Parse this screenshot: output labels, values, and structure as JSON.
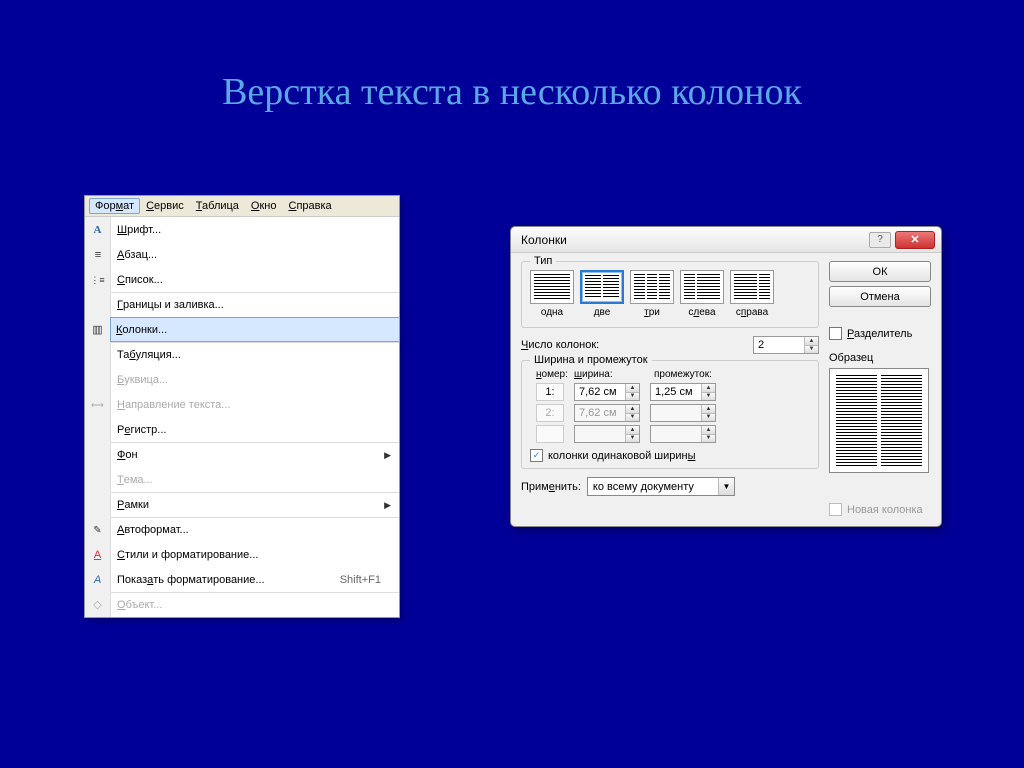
{
  "title": "Верстка текста в несколько колонок",
  "menubar": [
    {
      "label": "Формат",
      "mnemonic_index": 3
    },
    {
      "label": "Сервис",
      "mnemonic_index": 0
    },
    {
      "label": "Таблица",
      "mnemonic_index": 0
    },
    {
      "label": "Окно",
      "mnemonic_index": 0
    },
    {
      "label": "Справка",
      "mnemonic_index": 0
    }
  ],
  "menu_items": [
    {
      "id": "font",
      "label": "Шрифт...",
      "icon": "ic-font"
    },
    {
      "id": "paragraph",
      "label": "Абзац...",
      "icon": "ic-para"
    },
    {
      "id": "list",
      "label": "Список...",
      "icon": "ic-list"
    },
    {
      "id": "borders",
      "label": "Границы и заливка...",
      "sep": true
    },
    {
      "id": "columns",
      "label": "Колонки...",
      "icon": "ic-cols",
      "highlight": true
    },
    {
      "id": "tabs",
      "label": "Табуляция...",
      "sep": true
    },
    {
      "id": "dropcap",
      "label": "Буквица...",
      "disabled": true
    },
    {
      "id": "textdir",
      "label": "Направление текста...",
      "icon": "ic-dir",
      "disabled": true
    },
    {
      "id": "register",
      "label": "Регистр...",
      "sep": true
    },
    {
      "id": "background",
      "label": "Фон",
      "sep": true,
      "submenu": true
    },
    {
      "id": "theme",
      "label": "Тема...",
      "disabled": true
    },
    {
      "id": "frames",
      "label": "Рамки",
      "sep": true,
      "submenu": true
    },
    {
      "id": "autoformat",
      "label": "Автоформат...",
      "icon": "ic-autofmt",
      "sep": true
    },
    {
      "id": "styles",
      "label": "Стили и форматирование...",
      "icon": "ic-styles"
    },
    {
      "id": "revealfmt",
      "label": "Показать форматирование...",
      "icon": "ic-showfmt",
      "shortcut": "Shift+F1"
    },
    {
      "id": "object",
      "label": "Объект...",
      "icon": "ic-obj",
      "sep": true,
      "disabled": true
    }
  ],
  "dialog": {
    "title": "Колонки",
    "ok": "ОК",
    "cancel": "Отмена",
    "type_group": "Тип",
    "types": [
      "одна",
      "две",
      "три",
      "слева",
      "справа"
    ],
    "selected_type_index": 1,
    "count_label": "Число колонок:",
    "count_value": "2",
    "separator_label": "Разделитель",
    "separator_checked": false,
    "width_group": "Ширина и промежуток",
    "headers": {
      "num": "номер:",
      "width": "ширина:",
      "gap": "промежуток:"
    },
    "rows": [
      {
        "num": "1:",
        "width": "7,62 см",
        "gap": "1,25 см",
        "enabled": true
      },
      {
        "num": "2:",
        "width": "7,62 см",
        "gap": "",
        "enabled": false
      },
      {
        "num": "",
        "width": "",
        "gap": "",
        "enabled": false
      }
    ],
    "equal_label": "колонки одинаковой ширины",
    "equal_checked": true,
    "preview_group": "Образец",
    "apply_label": "Применить:",
    "apply_value": "ко всему документу",
    "newcol_label": "Новая колонка",
    "newcol_enabled": false
  }
}
